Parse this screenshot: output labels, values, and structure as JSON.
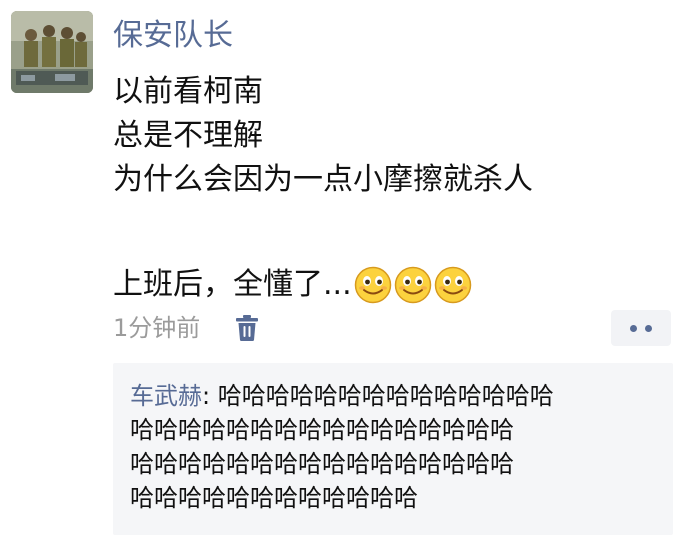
{
  "post": {
    "author": "保安队长",
    "lines": [
      "以前看柯南",
      "总是不理解",
      "为什么会因为一点小摩擦就杀人"
    ],
    "last_line": "上班后，全懂了...",
    "emojis": [
      "smile-emoji",
      "smile-emoji",
      "smile-emoji"
    ],
    "timestamp": "1分钟前",
    "delete_icon": "trash-icon",
    "more_icon": "more-dots-icon"
  },
  "comment": {
    "author": "车武赫",
    "separator": ": ",
    "rows": [
      "哈哈哈哈哈哈哈哈哈哈哈哈哈哈",
      "哈哈哈哈哈哈哈哈哈哈哈哈哈哈哈哈",
      "哈哈哈哈哈哈哈哈哈哈哈哈哈哈哈哈",
      "哈哈哈哈哈哈哈哈哈哈哈哈"
    ]
  },
  "colors": {
    "name_blue": "#576b95",
    "comment_bg": "#f5f6f8",
    "timestamp_gray": "#9b9b9b"
  }
}
